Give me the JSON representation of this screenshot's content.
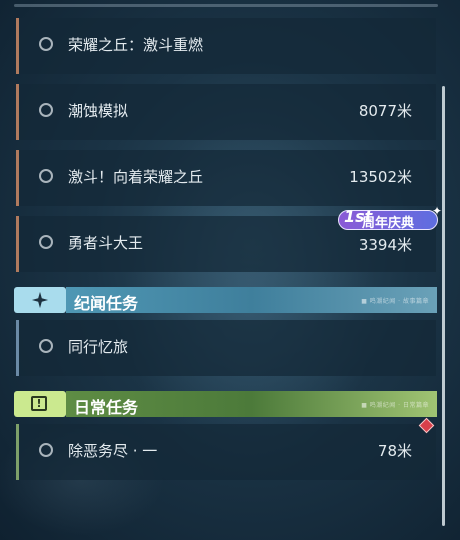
{
  "quests_top": [
    {
      "name": "荣耀之丘：激斗重燃",
      "distance": ""
    },
    {
      "name": "潮蚀模拟",
      "distance": "8077米"
    },
    {
      "name": "激斗！向着荣耀之丘",
      "distance": "13502米"
    },
    {
      "name": "勇者斗大王",
      "distance": "3394米"
    }
  ],
  "section_legend": {
    "title": "纪闻任务",
    "mini_text": "■ 鸣潮纪闻 · 故事篇章",
    "icon": "sparkle-star-icon",
    "accent": "#4f97b4",
    "quests": [
      {
        "name": "同行忆旅",
        "distance": ""
      }
    ]
  },
  "section_daily": {
    "title": "日常任务",
    "mini_text": "■ 鸣潮纪闻 · 日常篇章",
    "icon": "alert-box-icon",
    "accent": "#5e8c44",
    "quests": [
      {
        "name": "除恶务尽 · 一",
        "distance": "78米"
      }
    ]
  },
  "anniversary_badge": {
    "number": "1st",
    "label": "周年庆典"
  },
  "colors": {
    "quest_bar": "#b07a5e",
    "tracker_marker": "#d9404a"
  }
}
